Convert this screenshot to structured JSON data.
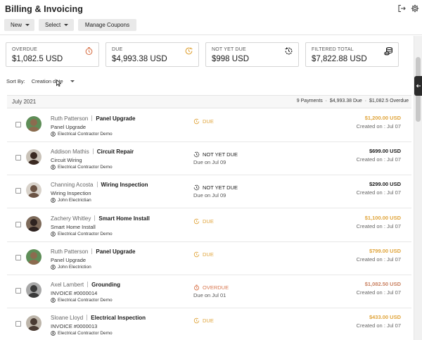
{
  "app": {
    "title": "Billing & Invoicing"
  },
  "toolbar": {
    "new_label": "New",
    "select_label": "Select",
    "coupons_label": "Manage Coupons"
  },
  "colors": {
    "due": "#e0a43a",
    "not_yet_due": "#1a1a1a",
    "overdue": "#d9774f"
  },
  "stats": [
    {
      "label": "OVERDUE",
      "value": "$1,082.5 USD",
      "icon": "alarm-clock-icon"
    },
    {
      "label": "DUE",
      "value": "$4,993.38 USD",
      "icon": "clock-due-icon"
    },
    {
      "label": "NOT YET DUE",
      "value": "$998 USD",
      "icon": "clock-forward-icon"
    },
    {
      "label": "FILTERED TOTAL",
      "value": "$7,822.88 USD",
      "icon": "coin-stack-icon"
    }
  ],
  "sort": {
    "label": "Sort By:",
    "value": "Creation date"
  },
  "group": {
    "month": "July 2021",
    "payments": "9 Payments",
    "due_total": "$4,993.38 Due",
    "overdue_total": "$1,082.5 Overdue"
  },
  "rows": [
    {
      "client": "Ruth Patterson",
      "job": "Panel Upgrade",
      "sub": "Panel Upgrade",
      "owner": "Electrical Contractor Demo",
      "status": "DUE",
      "status_type": "due",
      "due_date": "",
      "amount": "$1,200.00 USD",
      "created": "Created on : Jul 07"
    },
    {
      "client": "Addison Mathis",
      "job": "Circuit Repair",
      "sub": "Circuit Wiring",
      "owner": "Electrical Contractor Demo",
      "status": "NOT YET DUE",
      "status_type": "notdue",
      "due_date": "Due on Jul 09",
      "amount": "$699.00 USD",
      "created": "Created on : Jul 07"
    },
    {
      "client": "Channing Acosta",
      "job": "Wiring Inspection",
      "sub": "Wiring Inspection",
      "owner": "John Electrictian",
      "status": "NOT YET DUE",
      "status_type": "notdue",
      "due_date": "Due on Jul 09",
      "amount": "$299.00 USD",
      "created": "Created on : Jul 07"
    },
    {
      "client": "Zachery Whitley",
      "job": "Smart Home Install",
      "sub": "Smart Home Install",
      "owner": "Electrical Contractor Demo",
      "status": "DUE",
      "status_type": "due",
      "due_date": "",
      "amount": "$1,100.00 USD",
      "created": "Created on : Jul 07"
    },
    {
      "client": "Ruth Patterson",
      "job": "Panel Upgrade",
      "sub": "Panel Upgrade",
      "owner": "John Electriction",
      "status": "DUE",
      "status_type": "due",
      "due_date": "",
      "amount": "$799.00 USD",
      "created": "Created on : Jul 07"
    },
    {
      "client": "Axel Lambert",
      "job": "Grounding",
      "sub": "INVOICE #0000014",
      "owner": "Electrical Contractor Demo",
      "status": "OVERDUE",
      "status_type": "overdue",
      "due_date": "Due on Jul 01",
      "amount": "$1,082.50 USD",
      "created": "Created on : Jul 07"
    },
    {
      "client": "Sloane Lloyd",
      "job": "Electrical Inspection",
      "sub": "INVOICE #0000013",
      "owner": "Electrical Contractor Demo",
      "status": "DUE",
      "status_type": "due",
      "due_date": "",
      "amount": "$433.00 USD",
      "created": "Created on : Jul 07"
    }
  ]
}
